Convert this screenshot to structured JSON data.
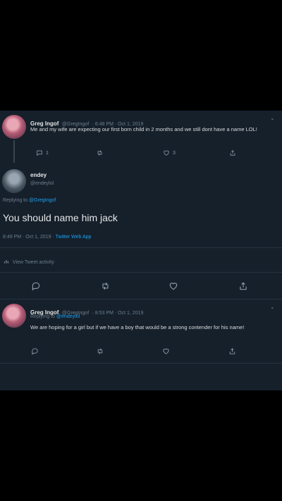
{
  "tweet1": {
    "display_name": "Greg Ingof",
    "handle": "@GregIngof",
    "meta": "· 6:48 PM · Oct 1, 2019",
    "text": "Me and my wife are expecting our first born child in 2 months and we still dont have a name LOL!",
    "reply_count": "1",
    "like_count": "3"
  },
  "tweet2": {
    "display_name": "endey",
    "handle": "@endeylol",
    "replying_prefix": "Replying to",
    "replying_to": "@GregIngof",
    "text": "You should name him jack",
    "time": "8:49 PM · Oct 1, 2019 ·",
    "source": "Twitter Web App",
    "activity": "View Tweet activity"
  },
  "tweet3": {
    "display_name": "Greg Ingof",
    "handle": "@GregIngof",
    "meta": "· 8:53 PM · Oct 1, 2019",
    "replying_prefix": "Replying to",
    "replying_to": "@endeylol",
    "text": "We are hoping for a girl but if we have a boy that would be a strong contender for his name!"
  },
  "colors": {
    "background": "#15202b",
    "accent": "#1da1f2",
    "muted": "#8899a6"
  }
}
